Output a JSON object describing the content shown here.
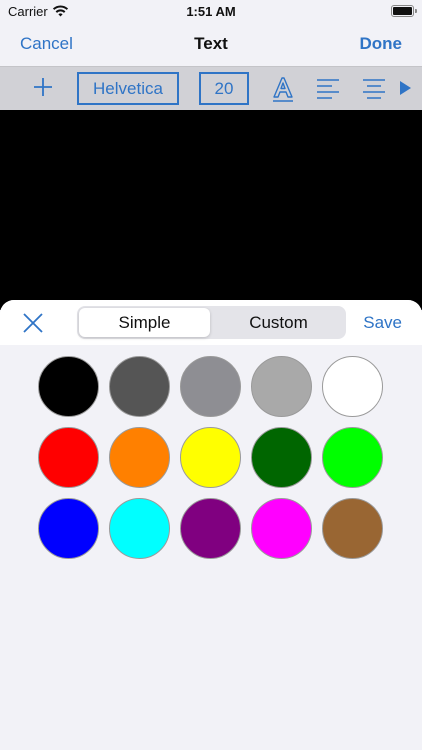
{
  "status_bar": {
    "carrier": "Carrier",
    "time": "1:51 AM"
  },
  "nav": {
    "cancel_label": "Cancel",
    "title": "Text",
    "done_label": "Done"
  },
  "toolbar": {
    "add_icon": "plus-icon",
    "font_name": "Helvetica",
    "font_size": "20",
    "icons": [
      "text-outline-icon",
      "align-left-icon",
      "align-center-icon",
      "more-arrow-icon"
    ]
  },
  "color_picker": {
    "close_icon": "close-icon",
    "tabs": [
      {
        "label": "Simple",
        "selected": true
      },
      {
        "label": "Custom",
        "selected": false
      }
    ],
    "save_label": "Save",
    "swatches": [
      [
        "#000000",
        "#555555",
        "#8e8e93",
        "#a9a9a9",
        "#ffffff"
      ],
      [
        "#ff0000",
        "#ff8000",
        "#ffff00",
        "#006600",
        "#00ff00"
      ],
      [
        "#0000ff",
        "#00ffff",
        "#800080",
        "#ff00ff",
        "#996633"
      ]
    ]
  },
  "colors": {
    "accent": "#2f74c6",
    "canvas": "#000000",
    "sheet_background": "#f2f2f7"
  }
}
